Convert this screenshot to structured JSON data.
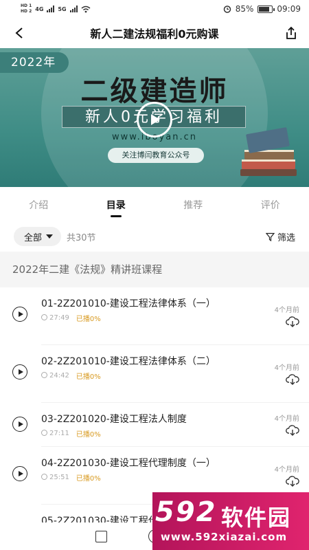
{
  "status_bar": {
    "hd1": "HD 1",
    "hd2": "HD 2",
    "net1": "4G",
    "net2": "5G",
    "alarm_icon": "alarm-icon",
    "battery": "85%",
    "battery_level": 0.85,
    "time": "09:09"
  },
  "nav": {
    "title": "新人二建法规福利0元购课",
    "back_icon": "back-arrow-icon",
    "share_icon": "share-icon"
  },
  "banner": {
    "year": "2022年",
    "headline": "二级建造师",
    "slogan": "新人0元学习福利",
    "url": "www.iboyan.cn",
    "follow": "关注博闫教育公众号"
  },
  "tabs": [
    {
      "label": "介绍",
      "active": false
    },
    {
      "label": "目录",
      "active": true
    },
    {
      "label": "推荐",
      "active": false
    },
    {
      "label": "评价",
      "active": false
    }
  ],
  "filter": {
    "chip": "全部",
    "count": "共30节",
    "filter_label": "筛选"
  },
  "section": {
    "title": "2022年二建《法规》精讲班课程"
  },
  "lessons": [
    {
      "title": "01-2Z201010-建设工程法律体系（一）",
      "duration": "27:49",
      "played": "已播0%",
      "ago": "4个月前"
    },
    {
      "title": "02-2Z201010-建设工程法律体系（二）",
      "duration": "24:42",
      "played": "已播0%",
      "ago": "4个月前"
    },
    {
      "title": "03-2Z201020-建设工程法人制度",
      "duration": "27:11",
      "played": "已播0%",
      "ago": "4个月前"
    },
    {
      "title": "04-2Z201030-建设工程代理制度（一）",
      "duration": "25:51",
      "played": "已播0%",
      "ago": "4个月前"
    },
    {
      "title": "05-2Z201030-建设工程代理制度",
      "duration": "",
      "played": "",
      "ago": ""
    }
  ],
  "watermark": {
    "number": "592",
    "cn": "软件园",
    "url": "www.592xiazai.com"
  },
  "colors": {
    "banner": "#3f8d86",
    "played": "#d89a20",
    "watermark": "#c8185f"
  }
}
